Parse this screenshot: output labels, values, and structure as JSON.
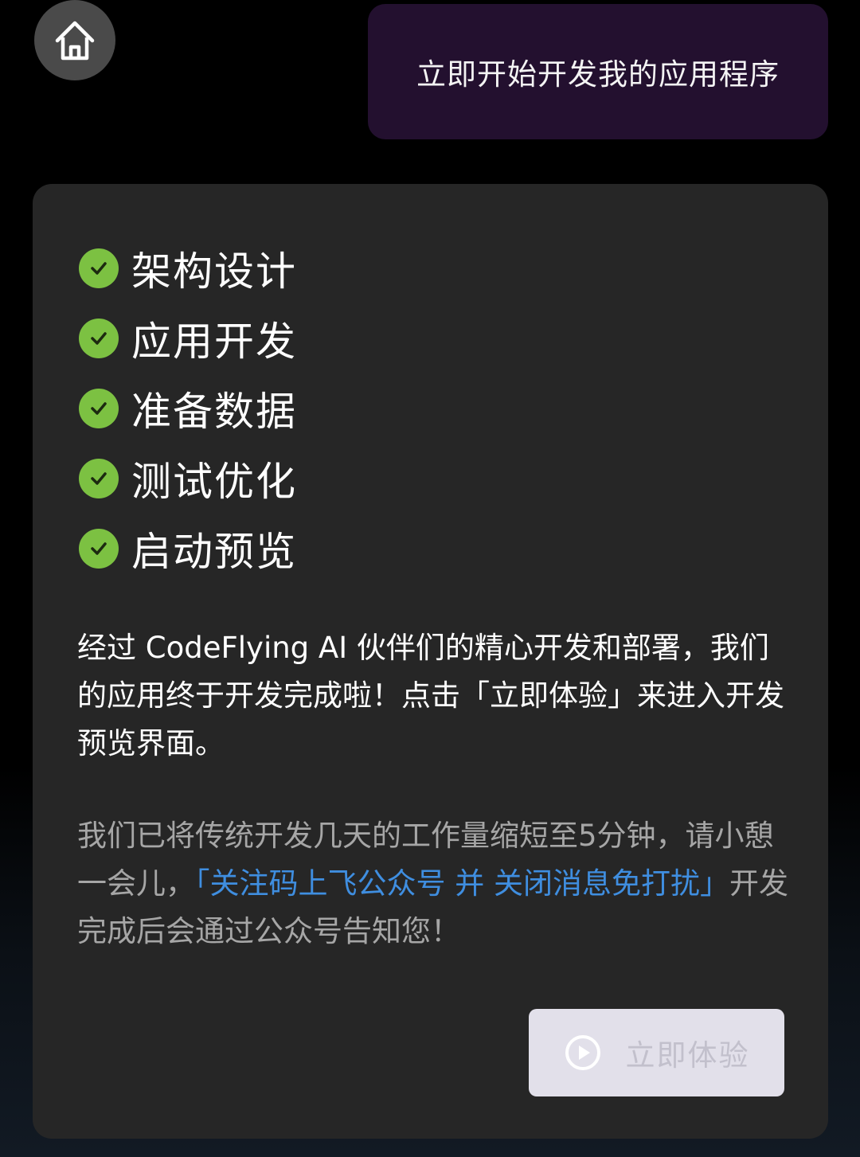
{
  "header": {
    "home_icon": "home-icon",
    "user_message": "立即开始开发我的应用程序"
  },
  "reply": {
    "steps": [
      {
        "label": "架构设计",
        "status": "done"
      },
      {
        "label": "应用开发",
        "status": "done"
      },
      {
        "label": "准备数据",
        "status": "done"
      },
      {
        "label": "测试优化",
        "status": "done"
      },
      {
        "label": "启动预览",
        "status": "done"
      }
    ],
    "paragraph1": "经过 CodeFlying AI 伙伴们的精心开发和部署，我们的应用终于开发完成啦！点击「立即体验」来进入开发预览界面。",
    "paragraph2_prefix": "我们已将传统开发几天的工作量缩短至5分钟，请小憩一会儿，",
    "paragraph2_link": "「关注码上飞公众号 并 关闭消息免打扰」",
    "paragraph2_suffix": "开发完成后会通过公众号告知您！",
    "try_button_label": "立即体验",
    "try_button_icon": "play-circle-icon"
  },
  "colors": {
    "check": "#7cc142",
    "link": "#3f8ee0",
    "bubble": "#23102f",
    "card": "#262626"
  }
}
